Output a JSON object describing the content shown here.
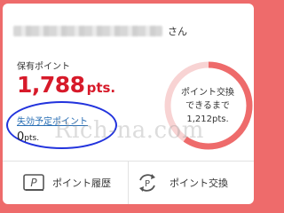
{
  "user": {
    "name_masked": "",
    "honorific": "さん"
  },
  "points": {
    "label": "保有ポイント",
    "value": "1,788",
    "unit": "pts."
  },
  "expiring": {
    "link_label": "失効予定ポイント",
    "value": "0",
    "unit": "pts."
  },
  "exchange_ring": {
    "line1": "ポイント交換",
    "line2": "できるまで",
    "remaining": "1,212pts.",
    "progress_fraction": 0.596,
    "color": "#ee6b6b",
    "track_color": "#f8d3d3"
  },
  "watermark": "Rich-na.com",
  "actions": {
    "history_label": "ポイント履歴",
    "exchange_label": "ポイント交換"
  },
  "icons": {
    "history": "p-card-icon",
    "exchange": "p-cycle-icon"
  },
  "colors": {
    "accent": "#ee6b6b",
    "points": "#d71a2a",
    "link": "#2a6fb5",
    "annotation": "#2233dd"
  }
}
